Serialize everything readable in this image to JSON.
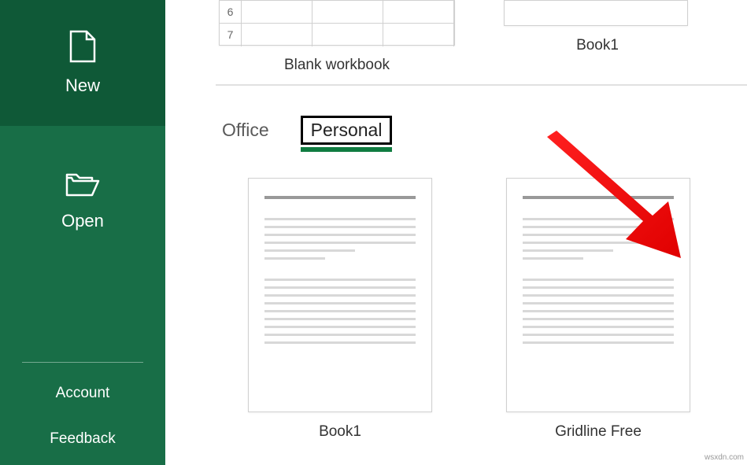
{
  "sidebar": {
    "new_label": "New",
    "open_label": "Open",
    "account_label": "Account",
    "feedback_label": "Feedback"
  },
  "top_templates": {
    "blank_workbook_label": "Blank workbook",
    "book1_label": "Book1",
    "row_numbers": [
      "6",
      "7"
    ]
  },
  "tabs": {
    "office_label": "Office",
    "personal_label": "Personal",
    "active": "Personal"
  },
  "personal_templates": {
    "book1_label": "Book1",
    "gridline_free_label": "Gridline Free"
  },
  "watermark": "wsxdn.com"
}
